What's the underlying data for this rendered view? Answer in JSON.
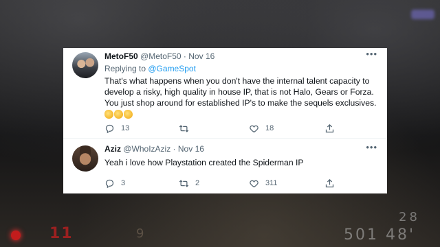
{
  "background_hud": {
    "left_value": "11",
    "mid_value": "9",
    "right_top": "28",
    "right_bottom": "501 48'"
  },
  "tweets": [
    {
      "name": "MetoF50",
      "handle": "@MetoF50",
      "separator": "·",
      "date": "Nov 16",
      "replying_prefix": "Replying to ",
      "replying_to": "@GameSpot",
      "text": "That's what happens when you don't have the internal talent capacity to develop a risky, high quality in house IP, that is not Halo, Gears or Forza. You just shop around for established IP's to make the sequels exclusives.",
      "emoji": [
        "clapping-hands",
        "clapping-hands",
        "clapping-hands"
      ],
      "replies": "13",
      "retweets": "",
      "likes": "18"
    },
    {
      "name": "Aziz",
      "handle": "@WhoIzAziz",
      "separator": "·",
      "date": "Nov 16",
      "text": "Yeah i love how Playstation created the Spiderman IP",
      "replies": "3",
      "retweets": "2",
      "likes": "311"
    }
  ],
  "icons": {
    "reply": "reply-icon",
    "retweet": "retweet-icon",
    "like": "heart-icon",
    "share": "share-icon",
    "more": "more-icon"
  },
  "colors": {
    "link": "#1d9bf0",
    "text": "#0f1419",
    "muted": "#536471"
  }
}
